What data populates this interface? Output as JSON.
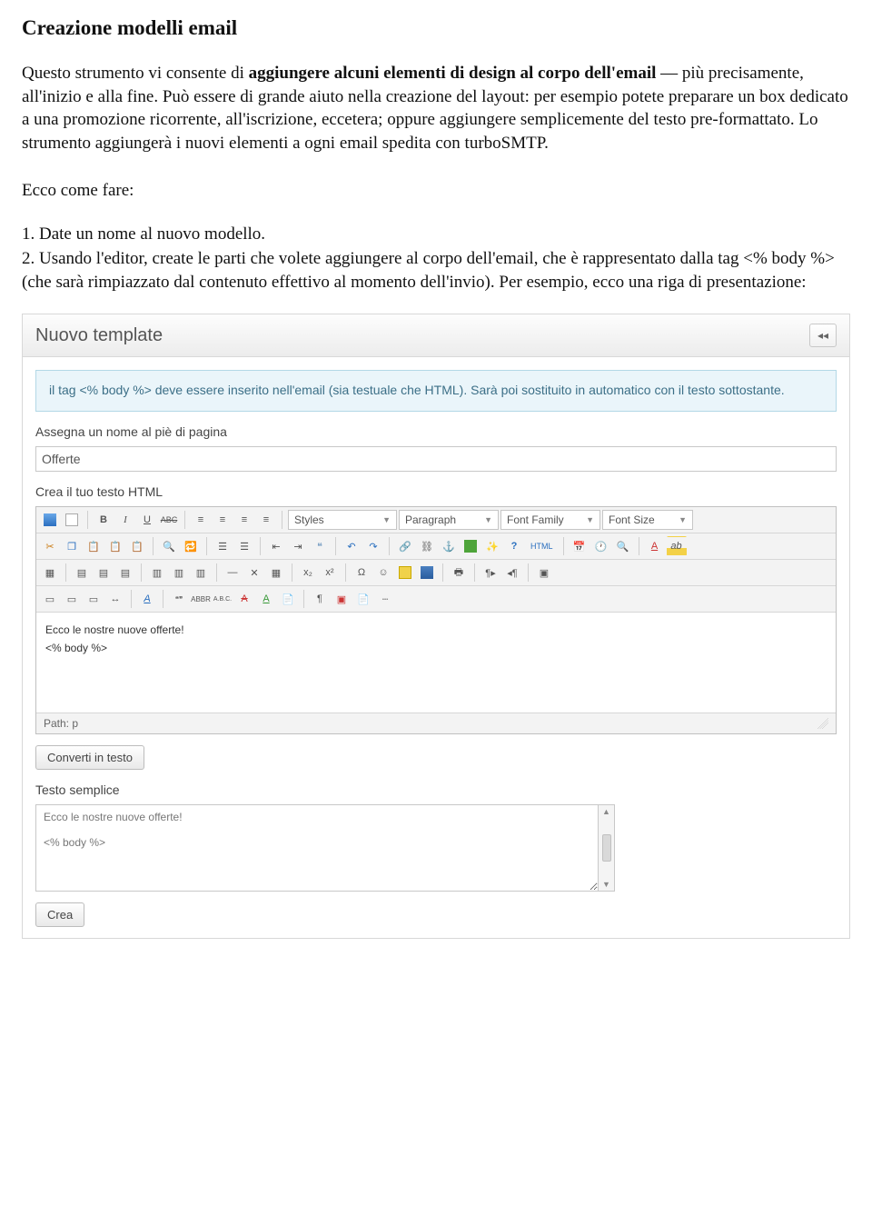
{
  "doc": {
    "title": "Creazione modelli email",
    "para1_a": "Questo strumento vi consente di ",
    "para1_b": "aggiungere alcuni elementi di design al corpo dell'email",
    "para1_c": " — più precisamente, all'inizio e alla fine. Può essere di grande aiuto nella creazione del layout: per esempio potete preparare un box dedicato a una promozione ricorrente, all'iscrizione, eccetera; oppure aggiungere semplicemente del testo pre-formattato. Lo strumento aggiungerà i nuovi elementi a ogni email spedita con turboSMTP.",
    "ecco": "Ecco come fare:",
    "item1": "1. Date un nome al nuovo modello.",
    "item2": "2. Usando l'editor, create le parti che volete aggiungere al corpo dell'email, che è rappresentato dalla tag <% body %> (che sarà rimpiazzato dal contenuto effettivo al momento dell'invio). Per esempio, ecco una riga di presentazione:"
  },
  "panel": {
    "title": "Nuovo template",
    "expand_glyph": "◂◂",
    "info": "il tag <% body %> deve essere inserito nell'email (sia testuale che HTML). Sarà poi sostituito in automatico con il testo sottostante.",
    "name_label": "Assegna un nome al piè di pagina",
    "name_value": "Offerte",
    "html_label": "Crea il tuo testo HTML"
  },
  "toolbar": {
    "row1": {
      "styles": "Styles",
      "paragraph": "Paragraph",
      "font_family": "Font Family",
      "font_size": "Font Size",
      "bold": "B",
      "italic": "I",
      "underline": "U",
      "strike": "ABC",
      "html": "HTML"
    }
  },
  "editor": {
    "line1": "Ecco le nostre nuove offerte!",
    "line2": "<% body %>",
    "path_label": "Path: p"
  },
  "convert_btn": "Converti in testo",
  "plain_label": "Testo semplice",
  "plain_text": "Ecco le nostre nuove offerte!\n\n<% body %>",
  "create_btn": "Crea"
}
